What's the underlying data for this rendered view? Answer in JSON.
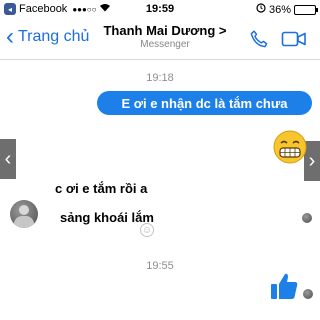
{
  "status_bar": {
    "app": "Facebook",
    "signal": "●●●○○",
    "time": "19:59",
    "battery": "36%",
    "battery_level": 0.36
  },
  "header": {
    "back_label": "Trang chủ",
    "contact_name": "Thanh Mai Dương >",
    "contact_subtitle": "Messenger"
  },
  "chat": {
    "timestamps": [
      "19:18",
      "19:55"
    ],
    "outgoing": [
      "E ơi e nhận dc là tắm chưa"
    ],
    "incoming": [
      "c ơi e tắm rồi a",
      "sảng khoái lắm"
    ]
  },
  "colors": {
    "accent": "#1d6fe0",
    "bubble": "#1d7fe8"
  },
  "icons": [
    "phone-icon",
    "video-call-icon",
    "grinning-emoji-icon",
    "like-thumb-icon",
    "add-reaction-icon"
  ]
}
